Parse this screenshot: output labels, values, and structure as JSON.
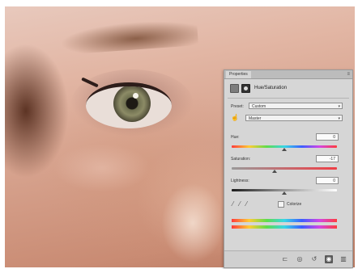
{
  "panel": {
    "tab_label": "Properties",
    "menu_glyph": "≡",
    "adjustment_title": "Hue/Saturation",
    "adjustment_icon": "hue-saturation-icon",
    "mask_icon": "layer-mask-icon",
    "preset_label": "Preset:",
    "preset_value": "Custom",
    "channel_value": "Master",
    "hue": {
      "label": "Hue:",
      "value": "0",
      "level_fraction": 0.5
    },
    "saturation": {
      "label": "Saturation:",
      "value": "-17",
      "level_fraction": 0.41
    },
    "lightness": {
      "label": "Lightness:",
      "value": "0",
      "level_fraction": 0.5
    },
    "eyedroppers": [
      "eyedropper-icon",
      "eyedropper-plus-icon",
      "eyedropper-minus-icon"
    ],
    "colorize_label": "Colorize",
    "colorize_checked": false,
    "footer_icons": [
      "clip-to-layer-icon",
      "view-previous-icon",
      "reset-icon",
      "visibility-icon",
      "trash-icon"
    ]
  },
  "colors": {
    "panel_bg": "#d6d6d6",
    "saturation_accent": "#ef3d45"
  }
}
